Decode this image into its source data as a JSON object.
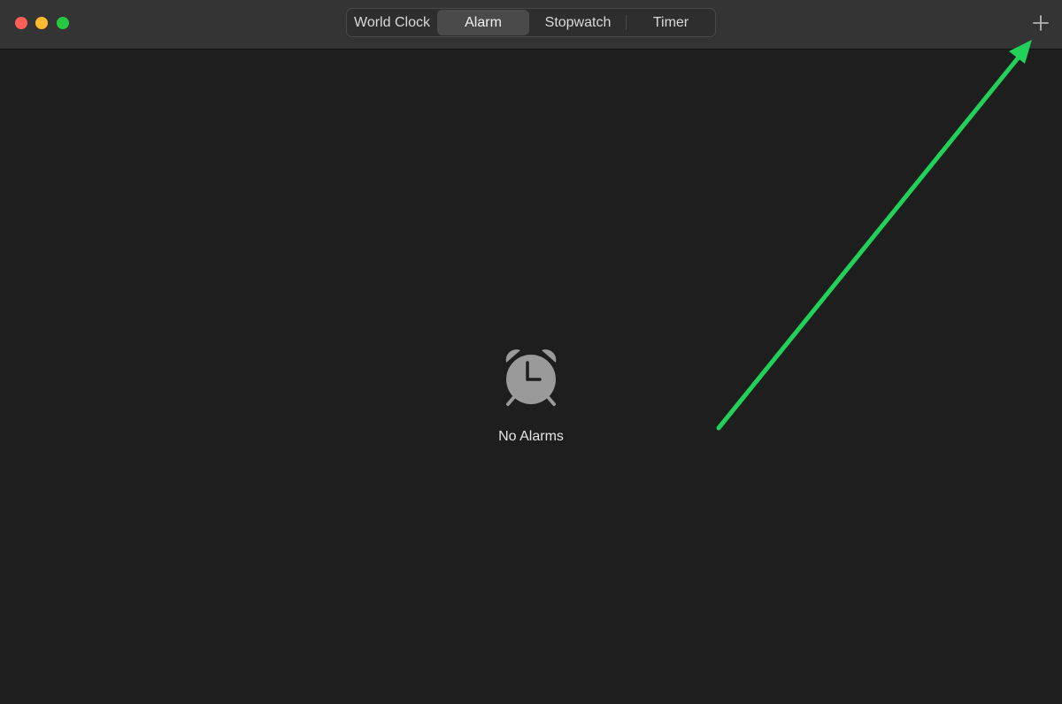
{
  "window": {
    "controls": [
      "close",
      "minimize",
      "zoom"
    ]
  },
  "tabs": [
    {
      "label": "World Clock",
      "selected": false
    },
    {
      "label": "Alarm",
      "selected": true
    },
    {
      "label": "Stopwatch",
      "selected": false
    },
    {
      "label": "Timer",
      "selected": false
    }
  ],
  "toolbar": {
    "add_icon": "plus-icon"
  },
  "empty_state": {
    "icon": "alarm-clock-icon",
    "message": "No Alarms"
  },
  "annotation": {
    "type": "arrow",
    "color": "#22d15a",
    "points_to": "add-button"
  },
  "colors": {
    "background": "#1e1e1e",
    "titlebar": "#343434",
    "selected_tab": "#4a4a4a",
    "icon_gray": "#9a9a9a",
    "close": "#fe5f57",
    "minimize": "#febc2e",
    "zoom": "#28c840"
  }
}
